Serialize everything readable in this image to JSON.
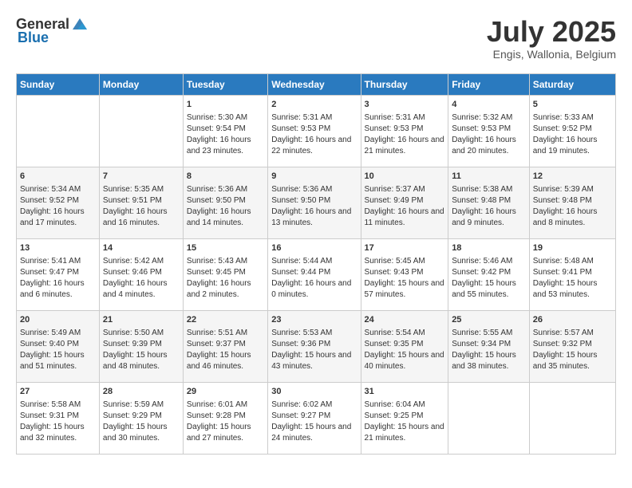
{
  "header": {
    "logo_general": "General",
    "logo_blue": "Blue",
    "month_year": "July 2025",
    "location": "Engis, Wallonia, Belgium"
  },
  "days_of_week": [
    "Sunday",
    "Monday",
    "Tuesday",
    "Wednesday",
    "Thursday",
    "Friday",
    "Saturday"
  ],
  "weeks": [
    [
      {
        "day": "",
        "content": ""
      },
      {
        "day": "",
        "content": ""
      },
      {
        "day": "1",
        "content": "Sunrise: 5:30 AM\nSunset: 9:54 PM\nDaylight: 16 hours and 23 minutes."
      },
      {
        "day": "2",
        "content": "Sunrise: 5:31 AM\nSunset: 9:53 PM\nDaylight: 16 hours and 22 minutes."
      },
      {
        "day": "3",
        "content": "Sunrise: 5:31 AM\nSunset: 9:53 PM\nDaylight: 16 hours and 21 minutes."
      },
      {
        "day": "4",
        "content": "Sunrise: 5:32 AM\nSunset: 9:53 PM\nDaylight: 16 hours and 20 minutes."
      },
      {
        "day": "5",
        "content": "Sunrise: 5:33 AM\nSunset: 9:52 PM\nDaylight: 16 hours and 19 minutes."
      }
    ],
    [
      {
        "day": "6",
        "content": "Sunrise: 5:34 AM\nSunset: 9:52 PM\nDaylight: 16 hours and 17 minutes."
      },
      {
        "day": "7",
        "content": "Sunrise: 5:35 AM\nSunset: 9:51 PM\nDaylight: 16 hours and 16 minutes."
      },
      {
        "day": "8",
        "content": "Sunrise: 5:36 AM\nSunset: 9:50 PM\nDaylight: 16 hours and 14 minutes."
      },
      {
        "day": "9",
        "content": "Sunrise: 5:36 AM\nSunset: 9:50 PM\nDaylight: 16 hours and 13 minutes."
      },
      {
        "day": "10",
        "content": "Sunrise: 5:37 AM\nSunset: 9:49 PM\nDaylight: 16 hours and 11 minutes."
      },
      {
        "day": "11",
        "content": "Sunrise: 5:38 AM\nSunset: 9:48 PM\nDaylight: 16 hours and 9 minutes."
      },
      {
        "day": "12",
        "content": "Sunrise: 5:39 AM\nSunset: 9:48 PM\nDaylight: 16 hours and 8 minutes."
      }
    ],
    [
      {
        "day": "13",
        "content": "Sunrise: 5:41 AM\nSunset: 9:47 PM\nDaylight: 16 hours and 6 minutes."
      },
      {
        "day": "14",
        "content": "Sunrise: 5:42 AM\nSunset: 9:46 PM\nDaylight: 16 hours and 4 minutes."
      },
      {
        "day": "15",
        "content": "Sunrise: 5:43 AM\nSunset: 9:45 PM\nDaylight: 16 hours and 2 minutes."
      },
      {
        "day": "16",
        "content": "Sunrise: 5:44 AM\nSunset: 9:44 PM\nDaylight: 16 hours and 0 minutes."
      },
      {
        "day": "17",
        "content": "Sunrise: 5:45 AM\nSunset: 9:43 PM\nDaylight: 15 hours and 57 minutes."
      },
      {
        "day": "18",
        "content": "Sunrise: 5:46 AM\nSunset: 9:42 PM\nDaylight: 15 hours and 55 minutes."
      },
      {
        "day": "19",
        "content": "Sunrise: 5:48 AM\nSunset: 9:41 PM\nDaylight: 15 hours and 53 minutes."
      }
    ],
    [
      {
        "day": "20",
        "content": "Sunrise: 5:49 AM\nSunset: 9:40 PM\nDaylight: 15 hours and 51 minutes."
      },
      {
        "day": "21",
        "content": "Sunrise: 5:50 AM\nSunset: 9:39 PM\nDaylight: 15 hours and 48 minutes."
      },
      {
        "day": "22",
        "content": "Sunrise: 5:51 AM\nSunset: 9:37 PM\nDaylight: 15 hours and 46 minutes."
      },
      {
        "day": "23",
        "content": "Sunrise: 5:53 AM\nSunset: 9:36 PM\nDaylight: 15 hours and 43 minutes."
      },
      {
        "day": "24",
        "content": "Sunrise: 5:54 AM\nSunset: 9:35 PM\nDaylight: 15 hours and 40 minutes."
      },
      {
        "day": "25",
        "content": "Sunrise: 5:55 AM\nSunset: 9:34 PM\nDaylight: 15 hours and 38 minutes."
      },
      {
        "day": "26",
        "content": "Sunrise: 5:57 AM\nSunset: 9:32 PM\nDaylight: 15 hours and 35 minutes."
      }
    ],
    [
      {
        "day": "27",
        "content": "Sunrise: 5:58 AM\nSunset: 9:31 PM\nDaylight: 15 hours and 32 minutes."
      },
      {
        "day": "28",
        "content": "Sunrise: 5:59 AM\nSunset: 9:29 PM\nDaylight: 15 hours and 30 minutes."
      },
      {
        "day": "29",
        "content": "Sunrise: 6:01 AM\nSunset: 9:28 PM\nDaylight: 15 hours and 27 minutes."
      },
      {
        "day": "30",
        "content": "Sunrise: 6:02 AM\nSunset: 9:27 PM\nDaylight: 15 hours and 24 minutes."
      },
      {
        "day": "31",
        "content": "Sunrise: 6:04 AM\nSunset: 9:25 PM\nDaylight: 15 hours and 21 minutes."
      },
      {
        "day": "",
        "content": ""
      },
      {
        "day": "",
        "content": ""
      }
    ]
  ]
}
